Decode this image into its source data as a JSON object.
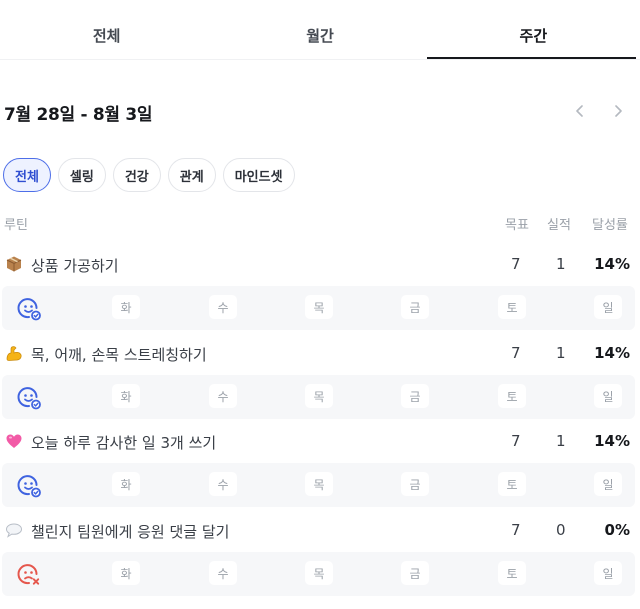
{
  "tabs": [
    {
      "label": "전체"
    },
    {
      "label": "월간"
    },
    {
      "label": "주간",
      "active": true
    }
  ],
  "week": {
    "title": "7월 28일 - 8월 3일",
    "prev_icon": "chevron-left-icon",
    "next_icon": "chevron-right-icon"
  },
  "filters": [
    {
      "label": "전체",
      "active": true
    },
    {
      "label": "셀링"
    },
    {
      "label": "건강"
    },
    {
      "label": "관계"
    },
    {
      "label": "마인드셋"
    }
  ],
  "columns": {
    "routine": "루틴",
    "goal": "목표",
    "actual": "실적",
    "rate": "달성률"
  },
  "weekdays": [
    "화",
    "수",
    "목",
    "금",
    "토",
    "일"
  ],
  "colors": {
    "accent": "#4d6ee8",
    "success_face": "#3f63e0",
    "fail_face": "#e5574d",
    "day_bg": "#f6f7f9"
  },
  "routines": [
    {
      "emoji": "package-icon",
      "name": "상품 가공하기",
      "goal": "7",
      "actual": "1",
      "rate": "14%",
      "status_icon": "smile-check-icon"
    },
    {
      "emoji": "flexed-biceps-icon",
      "name": "목, 어깨, 손목 스트레칭하기",
      "goal": "7",
      "actual": "1",
      "rate": "14%",
      "status_icon": "smile-check-icon"
    },
    {
      "emoji": "pink-heart-icon",
      "name": "오늘 하루 감사한 일 3개 쓰기",
      "goal": "7",
      "actual": "1",
      "rate": "14%",
      "status_icon": "smile-check-icon"
    },
    {
      "emoji": "speech-bubble-icon",
      "name": "챌린지 팀원에게 응원 댓글 달기",
      "goal": "7",
      "actual": "0",
      "rate": "0%",
      "status_icon": "sad-x-icon"
    }
  ]
}
